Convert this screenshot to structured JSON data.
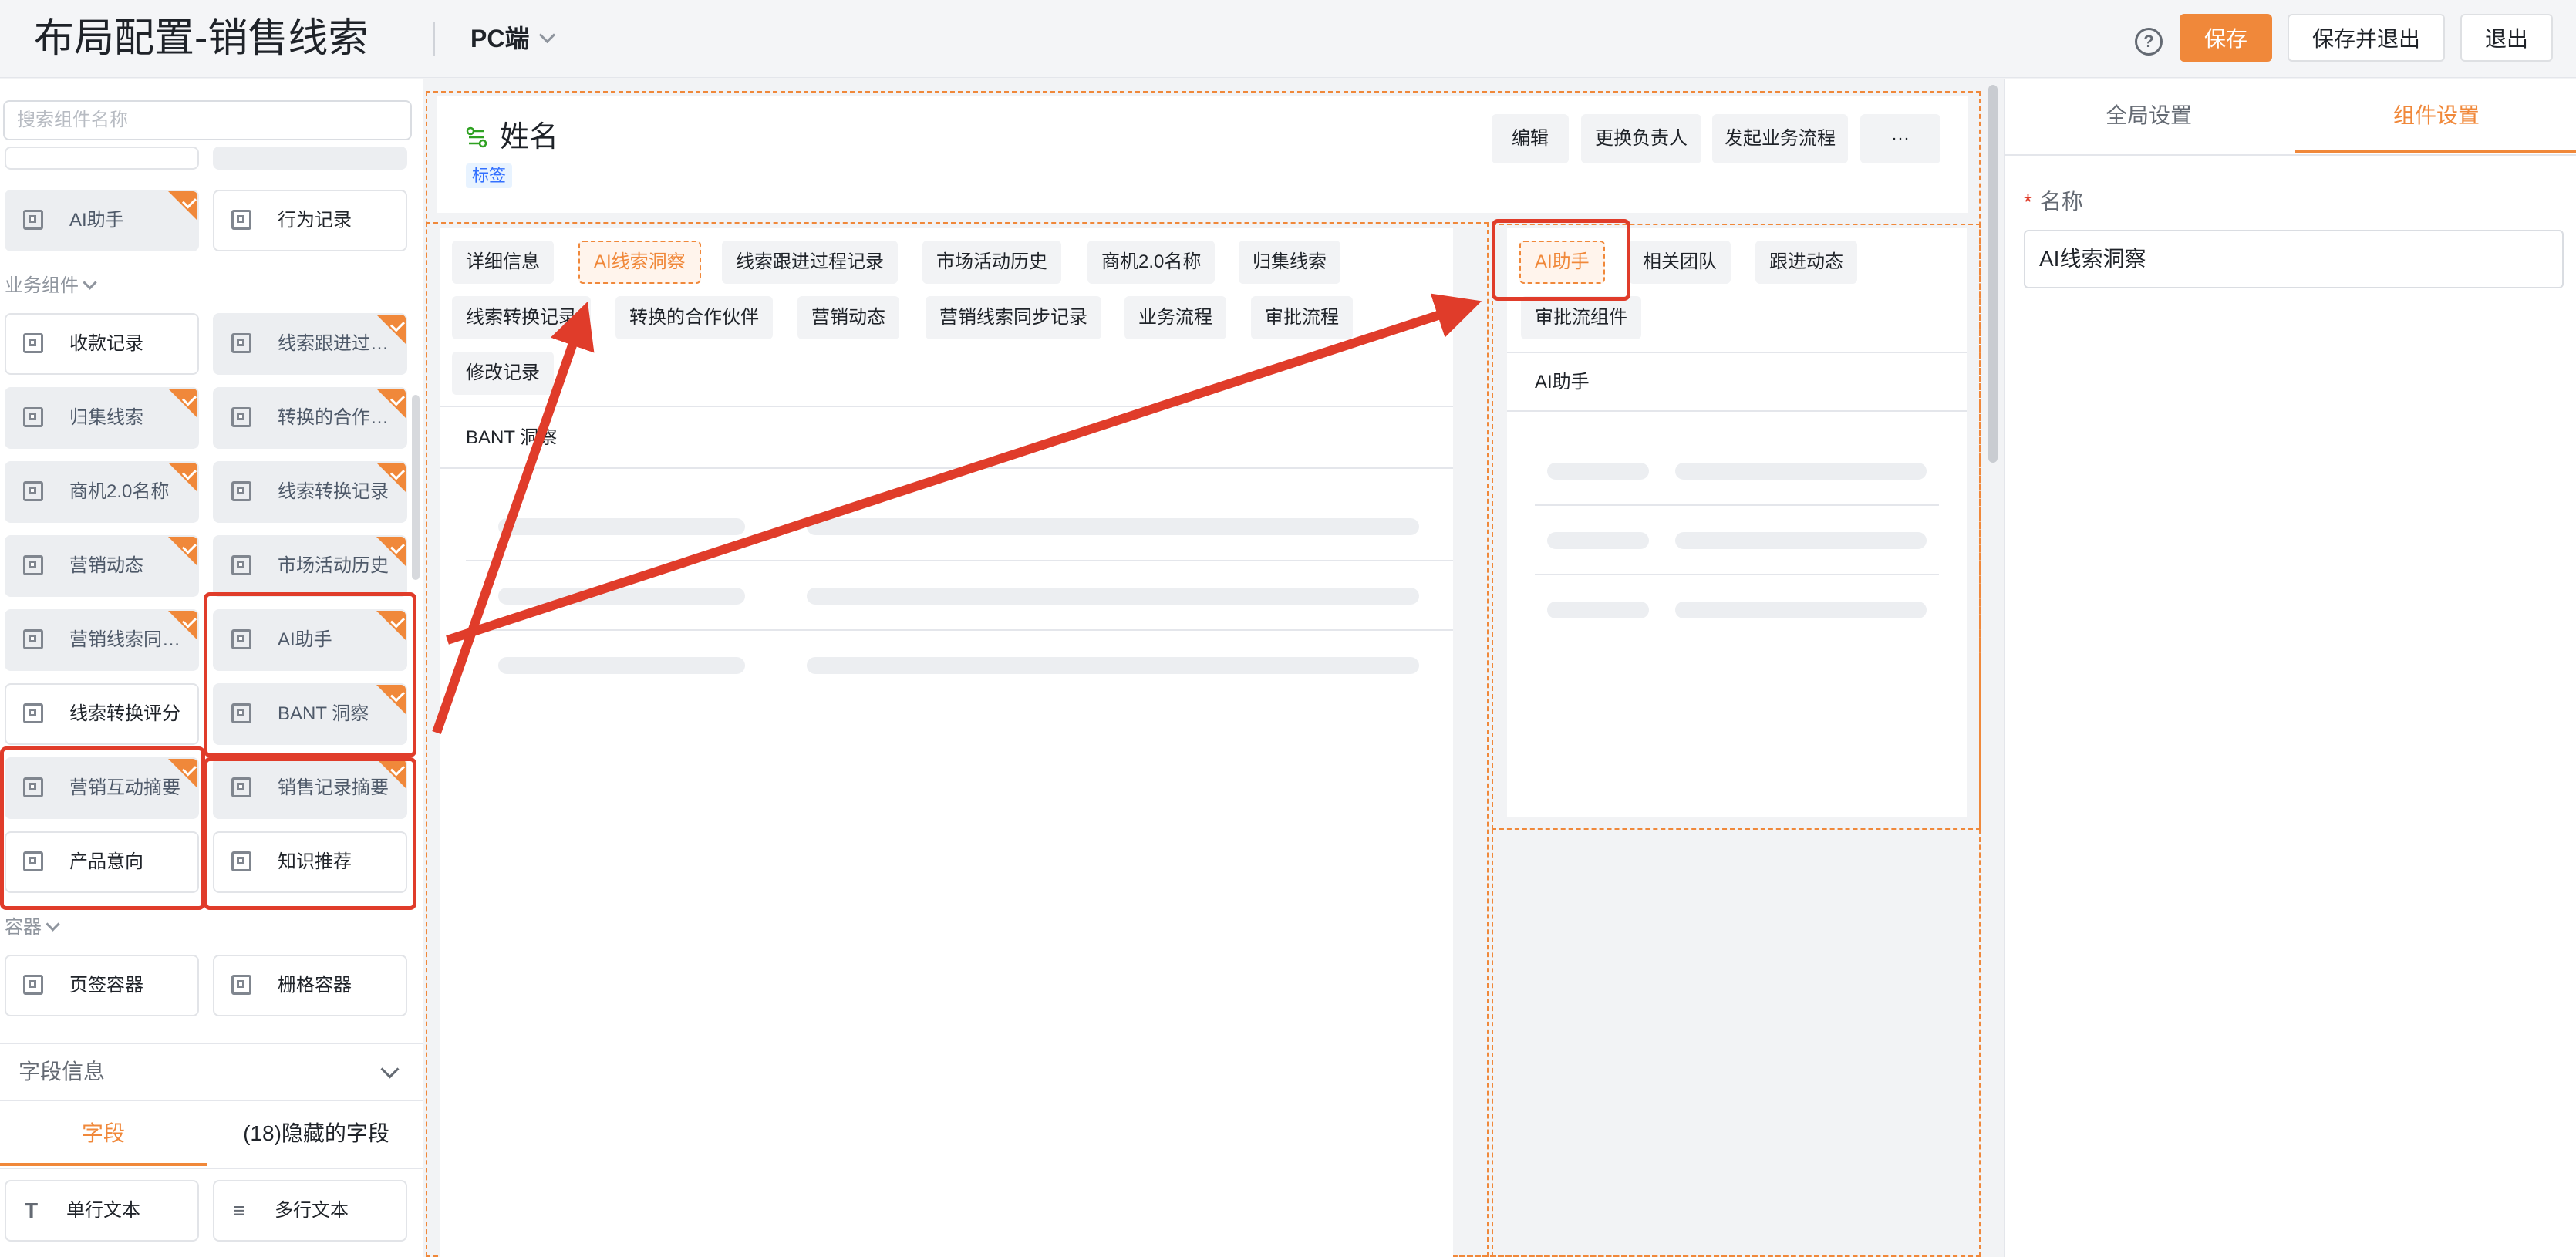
{
  "header": {
    "title": "布局配置-销售线索",
    "platform": "PC端",
    "help_icon": "?",
    "save": "保存",
    "save_exit": "保存并退出",
    "exit": "退出"
  },
  "left": {
    "search_placeholder": "搜索组件名称",
    "top_items": [
      "AI助手",
      "行为记录"
    ],
    "group_business": "业务组件",
    "business": [
      {
        "label": "收款记录",
        "used": false
      },
      {
        "label": "线索跟进过…",
        "used": true
      },
      {
        "label": "归集线索",
        "used": true
      },
      {
        "label": "转换的合作…",
        "used": true
      },
      {
        "label": "商机2.0名称",
        "used": true
      },
      {
        "label": "线索转换记录",
        "used": true
      },
      {
        "label": "营销动态",
        "used": true
      },
      {
        "label": "市场活动历史",
        "used": true
      },
      {
        "label": "营销线索同…",
        "used": true
      },
      {
        "label": "AI助手",
        "used": true
      },
      {
        "label": "线索转换评分",
        "used": false
      },
      {
        "label": "BANT 洞察",
        "used": true
      },
      {
        "label": "营销互动摘要",
        "used": true
      },
      {
        "label": "销售记录摘要",
        "used": true
      },
      {
        "label": "产品意向",
        "used": false
      },
      {
        "label": "知识推荐",
        "used": false
      }
    ],
    "group_container": "容器",
    "containers": [
      "页签容器",
      "栅格容器"
    ],
    "field_info": "字段信息",
    "field_tabs": [
      "字段",
      "(18)隐藏的字段"
    ],
    "fields": [
      "单行文本",
      "多行文本"
    ]
  },
  "canvas": {
    "name": "姓名",
    "tag": "标签",
    "actions": [
      "编辑",
      "更换负责人",
      "发起业务流程",
      "···"
    ],
    "main_tabs": [
      "详细信息",
      "AI线索洞察",
      "线索跟进过程记录",
      "市场活动历史",
      "商机2.0名称",
      "归集线索",
      "线索转换记录",
      "转换的合作伙伴",
      "营销动态",
      "营销线索同步记录",
      "业务流程",
      "审批流程",
      "修改记录"
    ],
    "main_section": "BANT 洞察",
    "side_tabs": [
      "AI助手",
      "相关团队",
      "跟进动态",
      "审批流组件"
    ],
    "side_section": "AI助手"
  },
  "right": {
    "tabs": [
      "全局设置",
      "组件设置"
    ],
    "active_tab": "组件设置",
    "field_label": "名称",
    "required_mark": "*",
    "field_value": "AI线索洞察"
  },
  "colors": {
    "accent": "#f0883a",
    "annotation": "#e03c2a"
  }
}
